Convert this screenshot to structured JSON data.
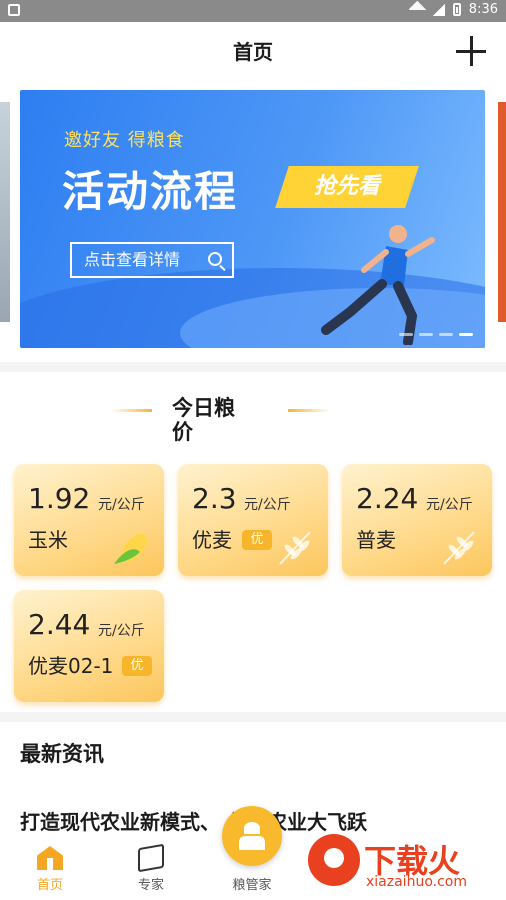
{
  "status_bar": {
    "time": "8:36"
  },
  "header": {
    "title": "首页"
  },
  "banner": {
    "tagline": "邀好友  得粮食",
    "headline": "活动流程",
    "ribbon": "抢先看",
    "detail_button": "点击查看详情"
  },
  "price_section": {
    "title": "今日粮价",
    "cards": [
      {
        "price": "1.92",
        "unit": "元/公斤",
        "name": "玉米",
        "badge": ""
      },
      {
        "price": "2.3",
        "unit": "元/公斤",
        "name": "优麦",
        "badge": "优"
      },
      {
        "price": "2.24",
        "unit": "元/公斤",
        "name": "普麦",
        "badge": ""
      },
      {
        "price": "2.44",
        "unit": "元/公斤",
        "name": "优麦02-1",
        "badge": "优"
      }
    ]
  },
  "news": {
    "title": "最新资讯",
    "items": [
      {
        "text": "打造现代农业新模式、    永年农业大飞跃"
      }
    ]
  },
  "tabbar": {
    "home": "首页",
    "experts": "专家",
    "butler": "粮管家"
  },
  "watermark": {
    "brand": "下载火",
    "url": "xiazaihuo.com"
  },
  "colors": {
    "accent": "#f5a623",
    "banner_blue": "#2e7ef2",
    "card_gold": "#fcc65c"
  }
}
